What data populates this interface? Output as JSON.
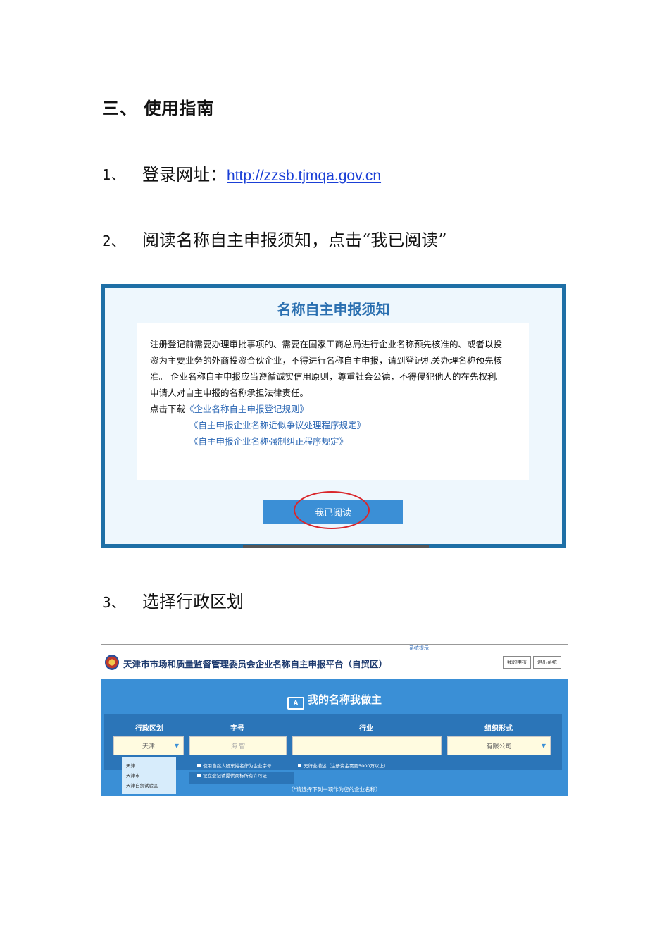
{
  "heading": "三、 使用指南",
  "steps": [
    {
      "num": "1、",
      "text": "登录网址：",
      "link": "http://zzsb.tjmqa.gov.cn"
    },
    {
      "num": "2、",
      "text": "阅读名称自主申报须知，点击“我已阅读”"
    },
    {
      "num": "3、",
      "text": "选择行政区划"
    }
  ],
  "notice": {
    "title": "名称自主申报须知",
    "lines": [
      "注册登记前需要办理审批事项的、需要在国家工商总局进行企业名称预先核准的、或者以投",
      "资为主要业务的外商投资合伙企业，不得进行名称自主申报，请到登记机关办理名称预先核",
      "准。 企业名称自主申报应当遵循诚实信用原则，尊重社会公德，不得侵犯他人的在先权利。",
      "申请人对自主申报的名称承担法律责任。"
    ],
    "download_prefix": "点击下载",
    "downloads": [
      "《企业名称自主申报登记规则》",
      "《自主申报企业名称近似争议处理程序规定》",
      "《自主申报企业名称强制纠正程序规定》"
    ],
    "read_button": "我已阅读"
  },
  "platform": {
    "sys_tip": "系统提示",
    "title": "天津市市场和质量监督管理委员会企业名称自主申报平台（自贸区）",
    "my_apply": "我的申报",
    "logout": "退出系统",
    "slogan_icon": "A",
    "slogan": "我的名称我做主",
    "columns": {
      "region": "行政区划",
      "word": "字号",
      "industry": "行业",
      "org": "组织形式"
    },
    "fields": {
      "region_value": "天津",
      "word_placeholder": "海 智",
      "industry_value": "",
      "org_value": "有限公司"
    },
    "region_options": [
      "天津",
      "天津市",
      "天津自贸试验区"
    ],
    "options": [
      "使用自然人股东姓名作为企业字号",
      "设立登记请提供商标所有许可证",
      "无行业描述（注册资金需要5000万以上）"
    ],
    "hint": "（*请选择下列一项作为您的企业名称）"
  }
}
